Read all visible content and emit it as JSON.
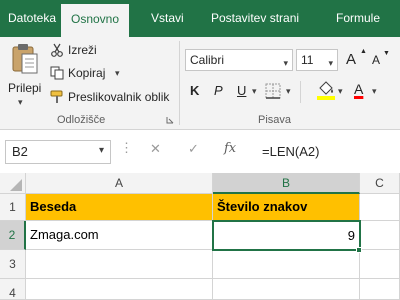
{
  "ribbon": {
    "tabs": [
      {
        "label": "Datoteka",
        "active": false
      },
      {
        "label": "Osnovno",
        "active": true
      },
      {
        "label": "Vstavi",
        "active": false
      },
      {
        "label": "Postavitev strani",
        "active": false
      },
      {
        "label": "Formule",
        "active": false
      }
    ],
    "clipboard": {
      "paste_label": "Prilepi",
      "cut_label": "Izreži",
      "copy_label": "Kopiraj",
      "format_painter_label": "Preslikovalnik oblik",
      "group_label": "Odložišče"
    },
    "font": {
      "font_name": "Calibri",
      "font_size": "11",
      "bold": "K",
      "italic": "P",
      "underline": "U",
      "grow_font": "A",
      "shrink_font": "A",
      "font_color_glyph": "A",
      "group_label": "Pisava"
    }
  },
  "formula_bar": {
    "name_box": "B2",
    "fx_label": "fx",
    "formula": "=LEN(A2)"
  },
  "sheet": {
    "columns": [
      "A",
      "B",
      "C"
    ],
    "rows": [
      "1",
      "2",
      "3",
      "4"
    ],
    "cells": {
      "A1": "Beseda",
      "B1": "Število znakov",
      "A2": "Zmaga.com",
      "B2": "9"
    },
    "header_fill": "#ffc000",
    "accent": "#217346"
  }
}
